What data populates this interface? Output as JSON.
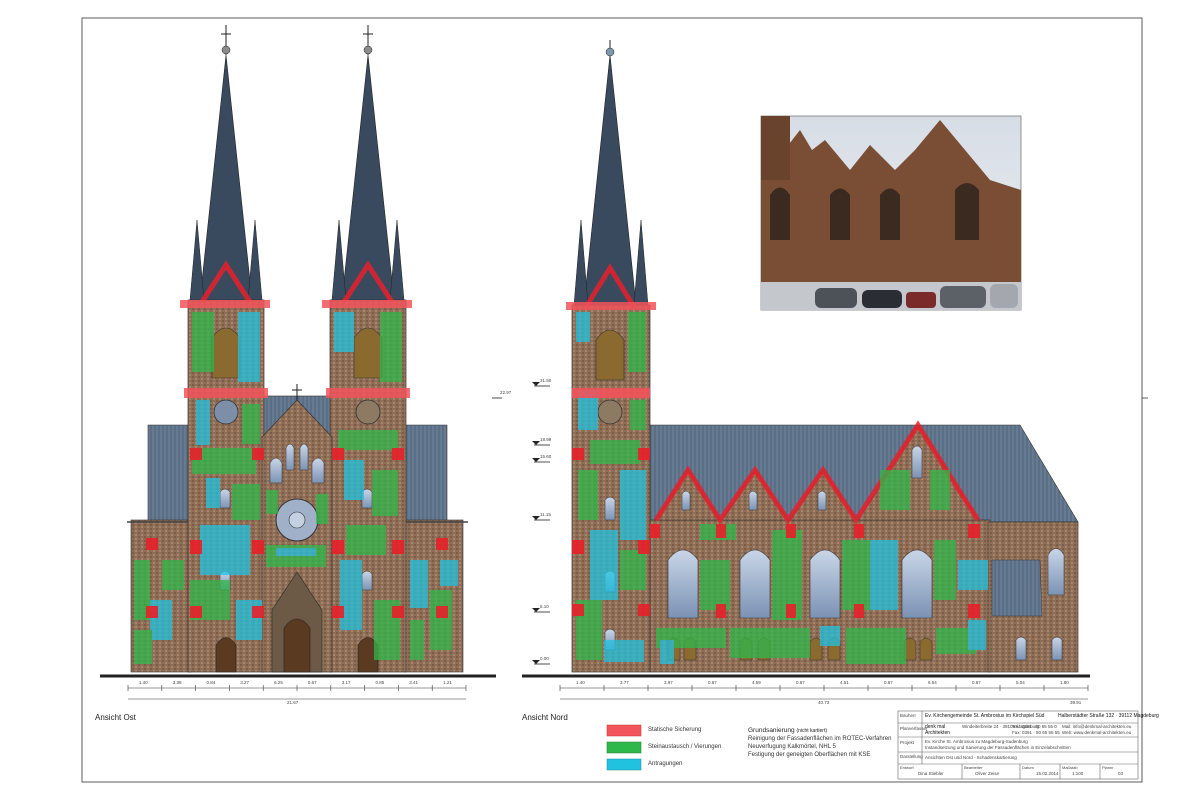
{
  "views": {
    "east_label": "Ansicht Ost",
    "north_label": "Ansicht Nord"
  },
  "legend": {
    "items": [
      {
        "label": "Statische Sicherung",
        "color": "#f2545b"
      },
      {
        "label": "Steinaustausch / Vierungen",
        "color": "#2fb84a"
      },
      {
        "label": "Antragungen",
        "color": "#21c2e0"
      }
    ]
  },
  "notes": {
    "heading": "Grundsanierung",
    "heading_suffix": "(nicht kartiert)",
    "lines": [
      "Reinigung der Fassadenflächen im ROTEC-Verfahren",
      "Neuverfugung Kalkmörtel, NHL 5",
      "Festigung der geneigten Oberflächen mit KSE"
    ]
  },
  "title_block": {
    "bauherr_label": "Bauherr",
    "bauherr": "Ev. Kirchengemeinde St. Ambrosius im Kirchspiel Süd",
    "bauherr_address": "Halberstädter Straße 132 · 39112 Magdeburg",
    "planverfasser_label": "Planverfasser",
    "office_name": "denk mal Architekten",
    "office_address": "Windeiterbreite 24 · 39108 Magdeburg",
    "office_tel": "Tel.: 0391 · 50 65 55 0",
    "office_fax": "Fax: 0391 · 50 65 55 55",
    "office_mail": "Mail: info@denkmal-architekten.eu",
    "office_web": "Web: www.denkmal-architekten.eu",
    "projekt_label": "Projekt",
    "projekt_line1": "Ev. Kirche St. Ambrosius zu Magdeburg-Sudenburg",
    "projekt_line2": "Instandsetzung und Sanierung der Fassadenflächen in Einzelabschnitten",
    "darstellung_label": "Darstellung",
    "darstellung": "Ansichten Ost und Nord - Schadenskartierung",
    "row_labels": [
      "Entwurf",
      "Bearbeiter",
      "Datum",
      "Maßstab",
      "Plannr."
    ],
    "drawer": "Dina Stiebler",
    "bearbeiter": "Oliver Zeise",
    "datum": "15.02.2014",
    "massstab": "1:100",
    "plannr": "03"
  },
  "elevation_marks": {
    "north": [
      "31.50",
      "18.99",
      "15.60",
      "11.15",
      "5.10",
      "0.00"
    ],
    "east": [
      "22.97"
    ]
  },
  "dimensions": {
    "east_segments": [
      "1.40",
      "3.38",
      "0.84",
      "3.27",
      "6.25",
      "0.67",
      "3.17",
      "0.85",
      "3.41",
      "1.21"
    ],
    "east_total": "21.67",
    "north_segments": [
      "1.40",
      "3.77",
      "3.97",
      "0.67",
      "4.59",
      "0.67",
      "4.51",
      "0.67",
      "6.54",
      "0.67",
      "5.04",
      "1.80"
    ],
    "north_total": "40.73",
    "north_total_sub": "39.91"
  },
  "photo": {
    "caption": ""
  }
}
